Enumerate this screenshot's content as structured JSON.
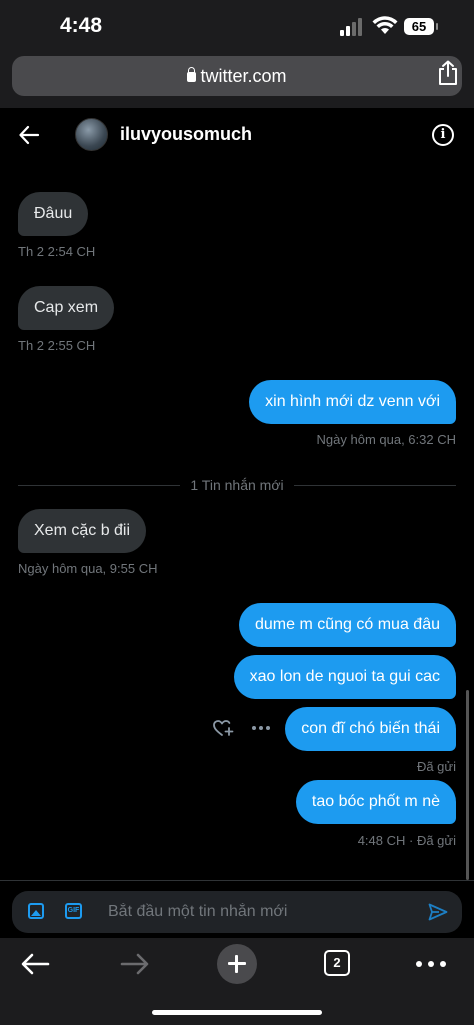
{
  "status_bar": {
    "time": "4:48",
    "battery": "65"
  },
  "browser": {
    "url": "twitter.com"
  },
  "header": {
    "username": "iluvyousomuch",
    "info_glyph": "i"
  },
  "messages": [
    {
      "dir": "in",
      "text": "Đâuu",
      "meta": "Th 2 2:54 CH"
    },
    {
      "dir": "in",
      "text": "Cap xem",
      "meta": "Th 2 2:55 CH"
    },
    {
      "dir": "out",
      "text": "xin hình mới dz venn với",
      "meta": "Ngày hôm qua, 6:32 CH"
    },
    {
      "dir": "in",
      "text": "Xem cặc b đii",
      "meta": "Ngày hôm qua, 9:55 CH"
    },
    {
      "dir": "out",
      "text": "dume m cũng có mua đâu",
      "meta": ""
    },
    {
      "dir": "out",
      "text": "xao lon de nguoi ta gui cac",
      "meta": ""
    },
    {
      "dir": "out",
      "text": "con đĩ chó biến thái",
      "meta": "Đã gửi"
    },
    {
      "dir": "out",
      "text": "tao bóc phốt m nè",
      "meta": "4:48 CH · Đã gửi"
    }
  ],
  "new_messages_divider": "1 Tin nhắn mới",
  "composer": {
    "placeholder": "Bắt đầu một tin nhắn mới",
    "gif_label": "GIF"
  },
  "toolbar": {
    "tab_count": "2"
  },
  "colors": {
    "accent": "#1d9bf0",
    "incoming_bubble": "#2f3336",
    "background": "#000000",
    "meta_text": "#71767b"
  },
  "icons": [
    "back-arrow-icon",
    "info-icon",
    "lock-icon",
    "share-icon",
    "image-icon",
    "gif-icon",
    "send-icon",
    "heart-plus-icon",
    "more-icon",
    "forward-arrow-icon",
    "plus-icon",
    "tabs-icon"
  ]
}
